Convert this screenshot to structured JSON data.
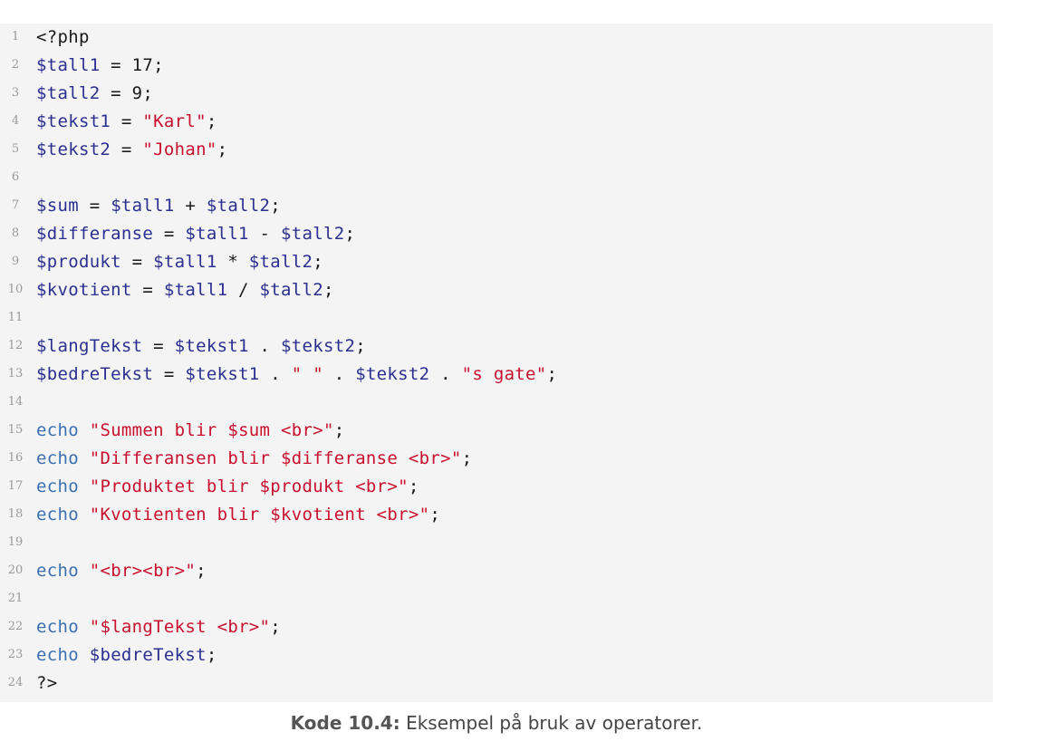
{
  "code": {
    "lines": [
      {
        "number": "1",
        "tokens": [
          {
            "t": "<?php",
            "k": "op"
          }
        ]
      },
      {
        "number": "2",
        "tokens": [
          {
            "t": "$tall1",
            "k": "var"
          },
          {
            "t": " = 17;",
            "k": "op"
          }
        ]
      },
      {
        "number": "3",
        "tokens": [
          {
            "t": "$tall2",
            "k": "var"
          },
          {
            "t": " = 9;",
            "k": "op"
          }
        ]
      },
      {
        "number": "4",
        "tokens": [
          {
            "t": "$tekst1",
            "k": "var"
          },
          {
            "t": " = ",
            "k": "op"
          },
          {
            "t": "\"Karl\"",
            "k": "str"
          },
          {
            "t": ";",
            "k": "op"
          }
        ]
      },
      {
        "number": "5",
        "tokens": [
          {
            "t": "$tekst2",
            "k": "var"
          },
          {
            "t": " = ",
            "k": "op"
          },
          {
            "t": "\"Johan\"",
            "k": "str"
          },
          {
            "t": ";",
            "k": "op"
          }
        ]
      },
      {
        "number": "6",
        "tokens": []
      },
      {
        "number": "7",
        "tokens": [
          {
            "t": "$sum",
            "k": "var"
          },
          {
            "t": " = ",
            "k": "op"
          },
          {
            "t": "$tall1",
            "k": "var"
          },
          {
            "t": " + ",
            "k": "op"
          },
          {
            "t": "$tall2",
            "k": "var"
          },
          {
            "t": ";",
            "k": "op"
          }
        ]
      },
      {
        "number": "8",
        "tokens": [
          {
            "t": "$differanse",
            "k": "var"
          },
          {
            "t": " = ",
            "k": "op"
          },
          {
            "t": "$tall1",
            "k": "var"
          },
          {
            "t": " - ",
            "k": "op"
          },
          {
            "t": "$tall2",
            "k": "var"
          },
          {
            "t": ";",
            "k": "op"
          }
        ]
      },
      {
        "number": "9",
        "tokens": [
          {
            "t": "$produkt",
            "k": "var"
          },
          {
            "t": " = ",
            "k": "op"
          },
          {
            "t": "$tall1",
            "k": "var"
          },
          {
            "t": " * ",
            "k": "op"
          },
          {
            "t": "$tall2",
            "k": "var"
          },
          {
            "t": ";",
            "k": "op"
          }
        ]
      },
      {
        "number": "10",
        "tokens": [
          {
            "t": "$kvotient",
            "k": "var"
          },
          {
            "t": " = ",
            "k": "op"
          },
          {
            "t": "$tall1",
            "k": "var"
          },
          {
            "t": " / ",
            "k": "op"
          },
          {
            "t": "$tall2",
            "k": "var"
          },
          {
            "t": ";",
            "k": "op"
          }
        ]
      },
      {
        "number": "11",
        "tokens": []
      },
      {
        "number": "12",
        "tokens": [
          {
            "t": "$langTekst",
            "k": "var"
          },
          {
            "t": " = ",
            "k": "op"
          },
          {
            "t": "$tekst1",
            "k": "var"
          },
          {
            "t": " . ",
            "k": "op"
          },
          {
            "t": "$tekst2",
            "k": "var"
          },
          {
            "t": ";",
            "k": "op"
          }
        ]
      },
      {
        "number": "13",
        "tokens": [
          {
            "t": "$bedreTekst",
            "k": "var"
          },
          {
            "t": " = ",
            "k": "op"
          },
          {
            "t": "$tekst1",
            "k": "var"
          },
          {
            "t": " . ",
            "k": "op"
          },
          {
            "t": "\" \"",
            "k": "str"
          },
          {
            "t": " . ",
            "k": "op"
          },
          {
            "t": "$tekst2",
            "k": "var"
          },
          {
            "t": " . ",
            "k": "op"
          },
          {
            "t": "\"s gate\"",
            "k": "str"
          },
          {
            "t": ";",
            "k": "op"
          }
        ]
      },
      {
        "number": "14",
        "tokens": []
      },
      {
        "number": "15",
        "tokens": [
          {
            "t": "echo",
            "k": "kw"
          },
          {
            "t": " ",
            "k": "op"
          },
          {
            "t": "\"Summen blir $sum <br>\"",
            "k": "str"
          },
          {
            "t": ";",
            "k": "op"
          }
        ]
      },
      {
        "number": "16",
        "tokens": [
          {
            "t": "echo",
            "k": "kw"
          },
          {
            "t": " ",
            "k": "op"
          },
          {
            "t": "\"Differansen blir $differanse <br>\"",
            "k": "str"
          },
          {
            "t": ";",
            "k": "op"
          }
        ]
      },
      {
        "number": "17",
        "tokens": [
          {
            "t": "echo",
            "k": "kw"
          },
          {
            "t": " ",
            "k": "op"
          },
          {
            "t": "\"Produktet blir $produkt <br>\"",
            "k": "str"
          },
          {
            "t": ";",
            "k": "op"
          }
        ]
      },
      {
        "number": "18",
        "tokens": [
          {
            "t": "echo",
            "k": "kw"
          },
          {
            "t": " ",
            "k": "op"
          },
          {
            "t": "\"Kvotienten blir $kvotient <br>\"",
            "k": "str"
          },
          {
            "t": ";",
            "k": "op"
          }
        ]
      },
      {
        "number": "19",
        "tokens": []
      },
      {
        "number": "20",
        "tokens": [
          {
            "t": "echo",
            "k": "kw"
          },
          {
            "t": " ",
            "k": "op"
          },
          {
            "t": "\"<br><br>\"",
            "k": "str"
          },
          {
            "t": ";",
            "k": "op"
          }
        ]
      },
      {
        "number": "21",
        "tokens": []
      },
      {
        "number": "22",
        "tokens": [
          {
            "t": "echo",
            "k": "kw"
          },
          {
            "t": " ",
            "k": "op"
          },
          {
            "t": "\"$langTekst <br>\"",
            "k": "str"
          },
          {
            "t": ";",
            "k": "op"
          }
        ]
      },
      {
        "number": "23",
        "tokens": [
          {
            "t": "echo",
            "k": "kw"
          },
          {
            "t": " ",
            "k": "op"
          },
          {
            "t": "$bedreTekst",
            "k": "var"
          },
          {
            "t": ";",
            "k": "op"
          }
        ]
      },
      {
        "number": "24",
        "tokens": [
          {
            "t": "?>",
            "k": "op"
          }
        ]
      }
    ]
  },
  "caption": {
    "label": "Kode 10.4:",
    "text": " Eksempel på bruk av operatorer."
  },
  "colors": {
    "background": "#f4f4f4",
    "variable": "#2b2f8f",
    "string": "#c8102e",
    "keyword": "#3a6fb0",
    "line_number": "#9a9a9a"
  }
}
